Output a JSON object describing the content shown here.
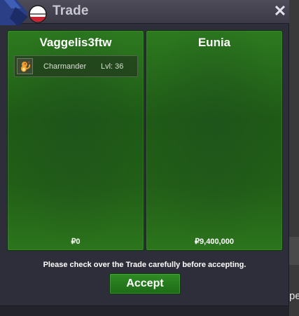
{
  "window": {
    "title": "Trade",
    "close_label": "✕"
  },
  "left_panel": {
    "player_name": "Vaggelis3ftw",
    "items": [
      {
        "name": "Charmander",
        "level": "Lvl: 36",
        "icon": "charmander-sprite-icon"
      }
    ],
    "money": "₽0"
  },
  "right_panel": {
    "player_name": "Eunia",
    "items": [],
    "money": "₽9,400,000"
  },
  "notice": "Please check over the Trade carefully before accepting.",
  "accept_label": "Accept",
  "background_peek_text": "pe",
  "colors": {
    "panel_green": "#236618",
    "window_bg": "#2e2d3a",
    "titlebar": "#44434f",
    "button_green": "#25801d"
  }
}
